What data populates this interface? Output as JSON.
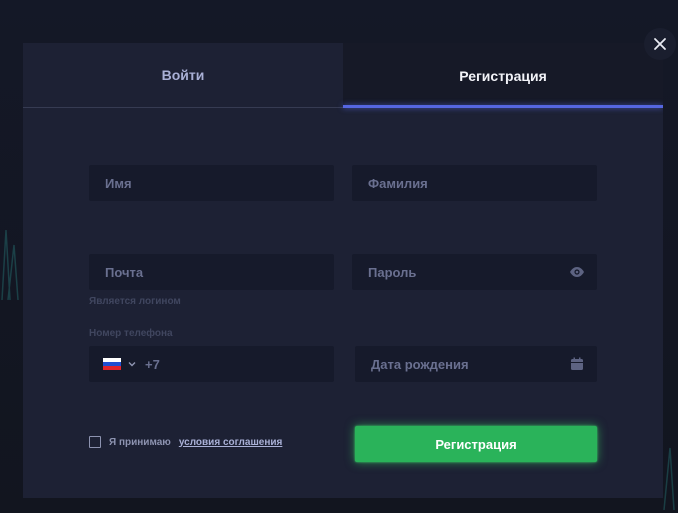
{
  "tabs": {
    "login_label": "Войти",
    "register_label": "Регистрация"
  },
  "form": {
    "name_placeholder": "Имя",
    "surname_placeholder": "Фамилия",
    "email_placeholder": "Почта",
    "email_hint": "Является логином",
    "password_placeholder": "Пароль",
    "phone_label": "Номер телефона",
    "phone_country": "ru-flag-icon",
    "phone_code": "+7",
    "birthdate_placeholder": "Дата рождения",
    "agree_text": "Я принимаю",
    "terms_link": "условия соглашения",
    "submit_label": "Регистрация"
  },
  "icons": {
    "close": "close-icon",
    "password_toggle": "eye-icon",
    "birthdate": "calendar-icon",
    "phone_dropdown": "chevron-down-icon"
  },
  "colors": {
    "modal_bg": "#1d2134",
    "field_bg": "#161a2b",
    "accent_tab": "#5566e0",
    "submit": "#2ab35a"
  }
}
